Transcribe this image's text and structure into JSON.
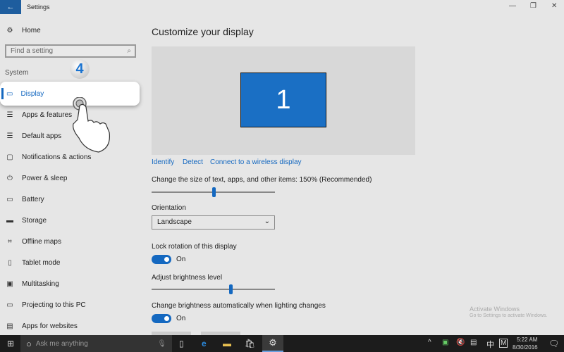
{
  "window": {
    "title": "Settings",
    "back": "←",
    "min": "—",
    "max": "❐",
    "close": "✕"
  },
  "sidebar": {
    "home": "Home",
    "search_placeholder": "Find a setting",
    "section": "System",
    "step_badge": "4",
    "items": [
      {
        "label": "Display",
        "icon": "monitor-icon",
        "glyph": "▭"
      },
      {
        "label": "Apps & features",
        "icon": "list-icon",
        "glyph": "☰"
      },
      {
        "label": "Default apps",
        "icon": "list-icon",
        "glyph": "☰"
      },
      {
        "label": "Notifications & actions",
        "icon": "message-icon",
        "glyph": "▢"
      },
      {
        "label": "Power & sleep",
        "icon": "power-icon",
        "glyph": "⏻"
      },
      {
        "label": "Battery",
        "icon": "battery-icon",
        "glyph": "▭"
      },
      {
        "label": "Storage",
        "icon": "storage-icon",
        "glyph": "▬"
      },
      {
        "label": "Offline maps",
        "icon": "map-icon",
        "glyph": "⌗"
      },
      {
        "label": "Tablet mode",
        "icon": "tablet-icon",
        "glyph": "▯"
      },
      {
        "label": "Multitasking",
        "icon": "multitask-icon",
        "glyph": "▣"
      },
      {
        "label": "Projecting to this PC",
        "icon": "project-icon",
        "glyph": "▭"
      },
      {
        "label": "Apps for websites",
        "icon": "web-app-icon",
        "glyph": "▤"
      }
    ]
  },
  "main": {
    "title": "Customize your display",
    "monitor_number": "1",
    "links": [
      "Identify",
      "Detect",
      "Connect to a wireless display"
    ],
    "scale_label": "Change the size of text, apps, and other items: 150% (Recommended)",
    "scale_slider_percent": 50,
    "orientation_label": "Orientation",
    "orientation_value": "Landscape",
    "lock_label": "Lock rotation of this display",
    "lock_state": "On",
    "brightness_label": "Adjust brightness level",
    "brightness_percent": 64,
    "auto_brightness_label": "Change brightness automatically when lighting changes",
    "auto_state": "On"
  },
  "watermark": {
    "title": "Activate Windows",
    "sub": "Go to Settings to activate Windows."
  },
  "taskbar": {
    "search": "Ask me anything",
    "time": "5:22 AM",
    "date": "8/30/2016",
    "ime": "中",
    "ime2": "M"
  },
  "colors": {
    "accent": "#1468c0",
    "taskbar": "#1c1c1c"
  }
}
